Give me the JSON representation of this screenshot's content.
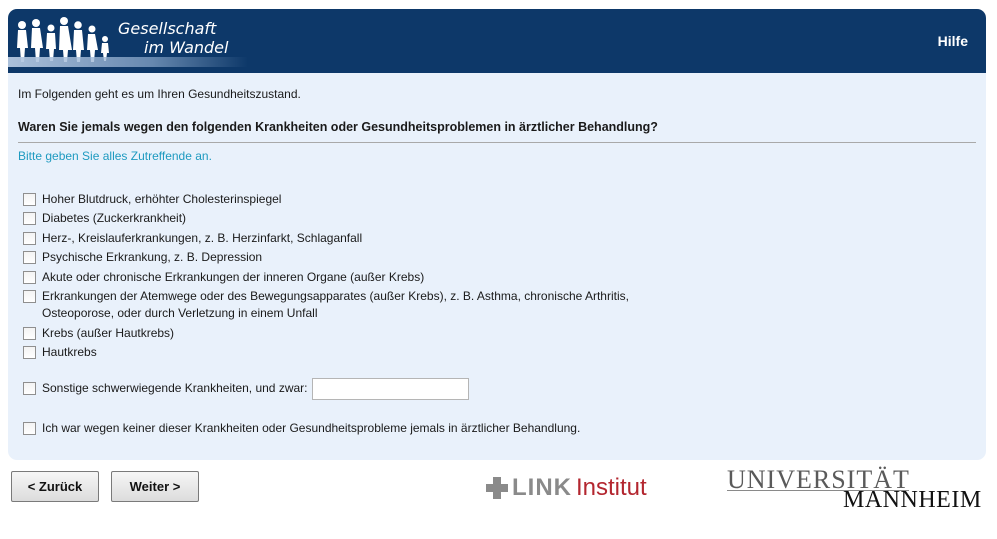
{
  "header": {
    "logo_line1": "Gesellschaft",
    "logo_line2": "im Wandel",
    "help_label": "Hilfe"
  },
  "survey": {
    "intro": "Im Folgenden geht es um Ihren Gesundheitszustand.",
    "question": "Waren Sie jemals wegen den folgenden Krankheiten oder Gesundheitsproblemen in ärztlicher Behandlung?",
    "instruction": "Bitte geben Sie alles Zutreffende an.",
    "options": [
      {
        "label": "Hoher Blutdruck, erhöhter Cholesterinspiegel",
        "checked": false
      },
      {
        "label": "Diabetes (Zuckerkrankheit)",
        "checked": false
      },
      {
        "label": "Herz-, Kreislauferkrankungen, z. B. Herzinfarkt, Schlaganfall",
        "checked": false
      },
      {
        "label": "Psychische Erkrankung, z. B. Depression",
        "checked": false
      },
      {
        "label": "Akute oder chronische Erkrankungen der inneren Organe (außer Krebs)",
        "checked": false
      },
      {
        "label_line1": "Erkrankungen der Atemwege oder des Bewegungsapparates (außer Krebs), z. B. Asthma, chronische Arthritis,",
        "label_line2": "Osteoporose, oder durch Verletzung in einem Unfall",
        "checked": false
      },
      {
        "label": "Krebs (außer Hautkrebs)",
        "checked": false
      },
      {
        "label": "Hautkrebs",
        "checked": false
      }
    ],
    "other": {
      "label": "Sonstige schwerwiegende Krankheiten, und zwar:",
      "value": "",
      "checked": false
    },
    "none": {
      "label": "Ich war wegen keiner dieser Krankheiten oder Gesundheitsprobleme jemals in ärztlicher Behandlung.",
      "checked": false
    }
  },
  "nav": {
    "back_label": "< Zurück",
    "next_label": "Weiter >"
  },
  "footer": {
    "link_word": "LINK",
    "institut_word": "Institut",
    "uni_line1": "UNIVERSITÄT",
    "uni_line2": "MANNHEIM"
  },
  "colors": {
    "header_bg": "#0d3869",
    "content_bg": "#e9f1fb",
    "instruction": "#1e9ac0",
    "link_red": "#b3262f"
  }
}
